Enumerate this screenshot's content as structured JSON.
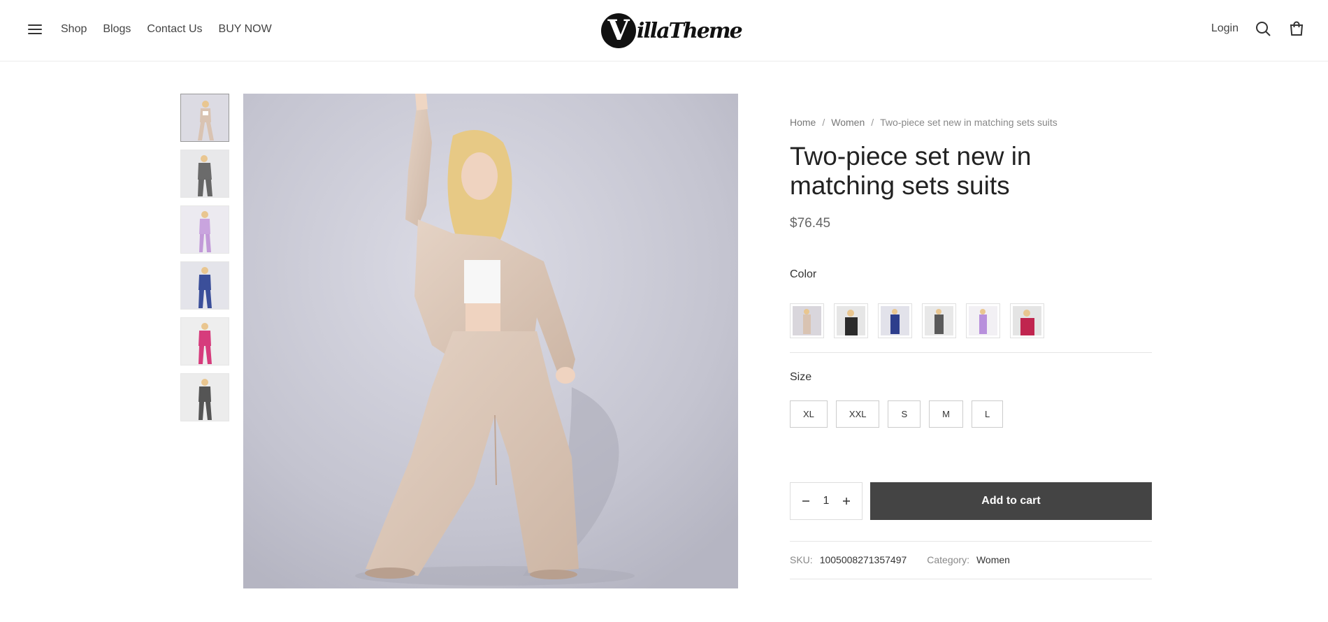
{
  "header": {
    "nav": [
      "Shop",
      "Blogs",
      "Contact Us",
      "BUY NOW"
    ],
    "logo_letter": "V",
    "logo_text": "illaTheme",
    "login_label": "Login"
  },
  "gallery": {
    "thumbnails": [
      {
        "name": "beige suit",
        "color": "#d9c3b2"
      },
      {
        "name": "grey suit",
        "color": "#6b6b6b"
      },
      {
        "name": "lilac suit",
        "color": "#c9a4de"
      },
      {
        "name": "blue suit",
        "color": "#3b4f9a"
      },
      {
        "name": "pink suit",
        "color": "#d63c7c"
      },
      {
        "name": "charcoal suit",
        "color": "#555555"
      }
    ]
  },
  "product": {
    "breadcrumb": [
      "Home",
      "Women",
      "Two-piece set new in matching sets suits"
    ],
    "title": "Two-piece set new in matching sets suits",
    "price": "$76.45",
    "color_label": "Color",
    "color_swatches": [
      "#d9c3b2",
      "#2b2b2b",
      "#2d3e8c",
      "#5a5a5a",
      "#b890dc",
      "#c0254f"
    ],
    "size_label": "Size",
    "sizes": [
      "XL",
      "XXL",
      "S",
      "M",
      "L"
    ],
    "quantity": "1",
    "add_to_cart_label": "Add to cart",
    "sku_label": "SKU:",
    "sku_value": "1005008271357497",
    "category_label": "Category:",
    "category_value": "Women"
  }
}
